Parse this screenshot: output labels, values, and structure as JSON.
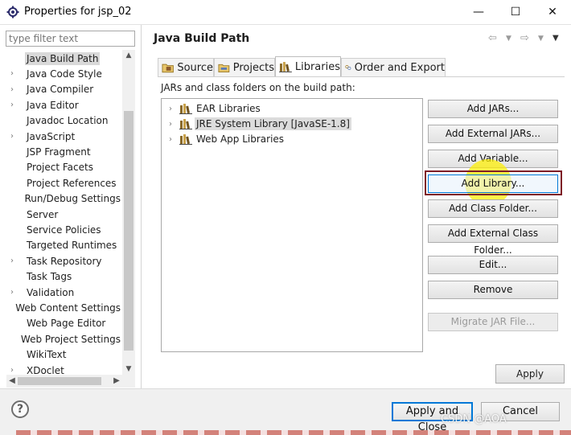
{
  "window": {
    "title": "Properties for jsp_02",
    "minimize": "—",
    "maximize": "☐",
    "close": "✕"
  },
  "filter": {
    "placeholder": "type filter text"
  },
  "tree": {
    "items": [
      {
        "label": "Java Build Path",
        "expandable": false,
        "selected": true
      },
      {
        "label": "Java Code Style",
        "expandable": true
      },
      {
        "label": "Java Compiler",
        "expandable": true
      },
      {
        "label": "Java Editor",
        "expandable": true
      },
      {
        "label": "Javadoc Location",
        "expandable": false
      },
      {
        "label": "JavaScript",
        "expandable": true
      },
      {
        "label": "JSP Fragment",
        "expandable": false
      },
      {
        "label": "Project Facets",
        "expandable": false
      },
      {
        "label": "Project References",
        "expandable": false
      },
      {
        "label": "Run/Debug Settings",
        "expandable": false
      },
      {
        "label": "Server",
        "expandable": false
      },
      {
        "label": "Service Policies",
        "expandable": false
      },
      {
        "label": "Targeted Runtimes",
        "expandable": false
      },
      {
        "label": "Task Repository",
        "expandable": true
      },
      {
        "label": "Task Tags",
        "expandable": false
      },
      {
        "label": "Validation",
        "expandable": true
      },
      {
        "label": "Web Content Settings",
        "expandable": false
      },
      {
        "label": "Web Page Editor",
        "expandable": false
      },
      {
        "label": "Web Project Settings",
        "expandable": false
      },
      {
        "label": "WikiText",
        "expandable": false
      },
      {
        "label": "XDoclet",
        "expandable": true
      }
    ]
  },
  "page": {
    "heading": "Java Build Path"
  },
  "tabs": [
    {
      "label": "Source",
      "icon": "source-folder-icon"
    },
    {
      "label": "Projects",
      "icon": "projects-icon"
    },
    {
      "label": "Libraries",
      "icon": "libraries-icon",
      "active": true
    },
    {
      "label": "Order and Export",
      "icon": "order-export-icon"
    }
  ],
  "libraries": {
    "caption": "JARs and class folders on the build path:",
    "items": [
      {
        "label": "EAR Libraries"
      },
      {
        "label": "JRE System Library [JavaSE-1.8]",
        "selected": true
      },
      {
        "label": "Web App Libraries"
      }
    ]
  },
  "buttons": {
    "add_jars": "Add JARs...",
    "add_external_jars": "Add External JARs...",
    "add_variable": "Add Variable...",
    "add_library": "Add Library...",
    "add_class_folder": "Add Class Folder...",
    "add_external_class_folder": "Add External Class Folder...",
    "edit": "Edit...",
    "remove": "Remove",
    "migrate_jar": "Migrate JAR File...",
    "apply": "Apply"
  },
  "footer": {
    "help": "?",
    "apply_and_close": "Apply and Close",
    "cancel": "Cancel",
    "watermark": "CSDN @AOA"
  },
  "colors": {
    "accent": "#0078d7",
    "focus_outline": "#7d1b26",
    "highlight": "#fff000"
  }
}
